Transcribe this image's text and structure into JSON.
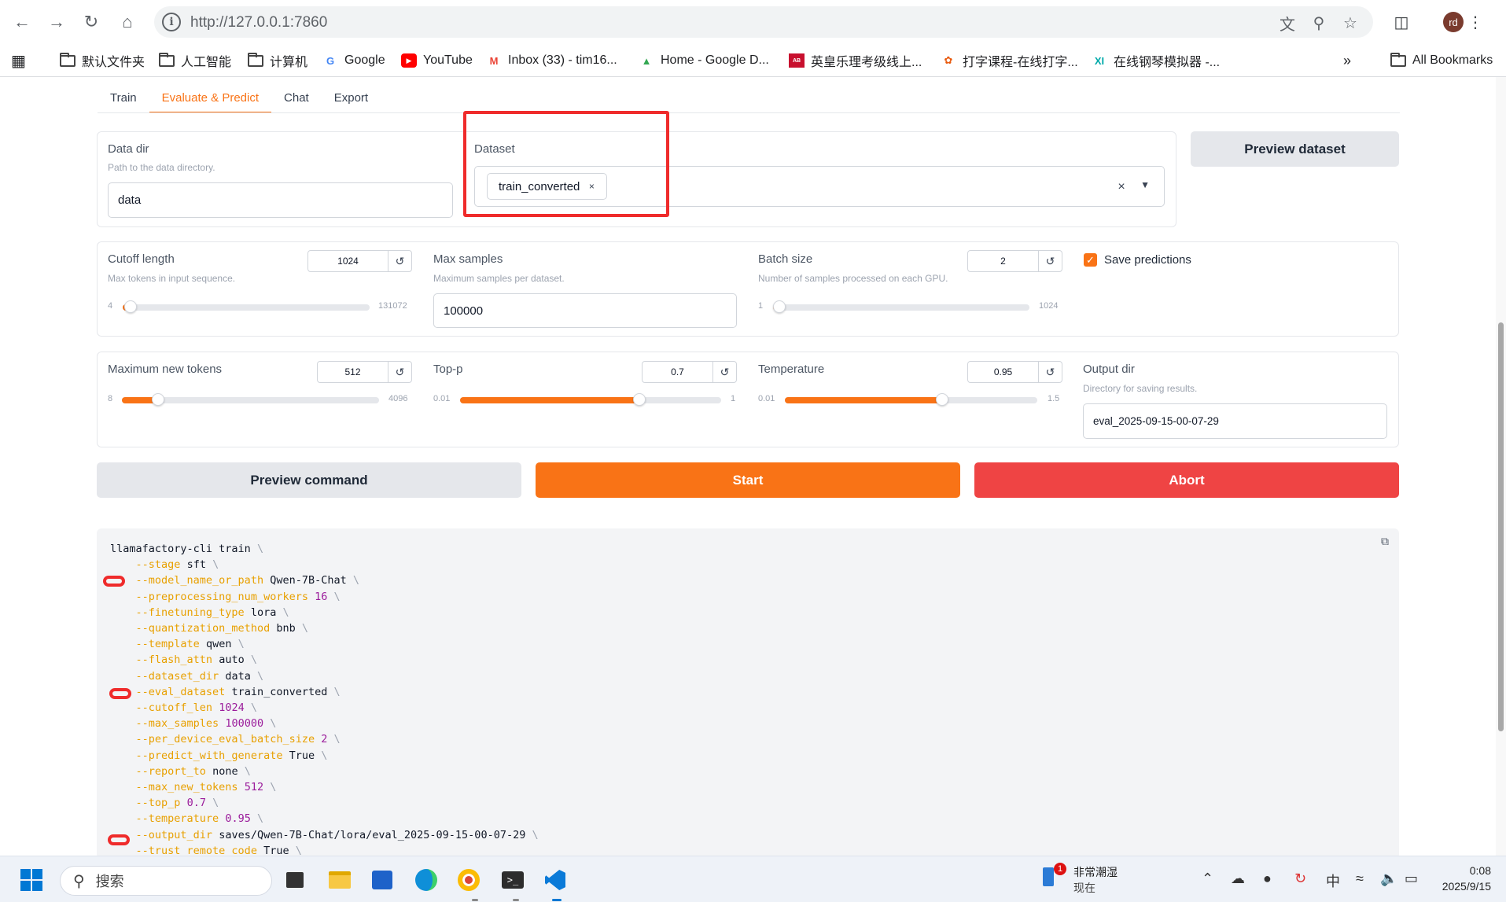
{
  "browser": {
    "url": "http://127.0.0.1:7860",
    "avatar": "rd",
    "bookmarks": [
      {
        "label": "默认文件夹",
        "icon": "folder-icon"
      },
      {
        "label": "人工智能",
        "icon": "folder-icon"
      },
      {
        "label": "计算机",
        "icon": "folder-icon"
      },
      {
        "label": "Google",
        "icon": "google-icon"
      },
      {
        "label": "YouTube",
        "icon": "youtube-icon"
      },
      {
        "label": "Inbox (33) - tim16...",
        "icon": "gmail-icon"
      },
      {
        "label": "Home - Google D...",
        "icon": "drive-icon"
      },
      {
        "label": "英皇乐理考级线上...",
        "icon": "site-icon"
      },
      {
        "label": "打字课程-在线打字...",
        "icon": "site-icon"
      },
      {
        "label": "在线钢琴模拟器 -...",
        "icon": "site-icon"
      }
    ],
    "all_bookmarks": "All Bookmarks"
  },
  "tabs": [
    "Train",
    "Evaluate & Predict",
    "Chat",
    "Export"
  ],
  "active_tab": "Evaluate & Predict",
  "data_dir": {
    "label": "Data dir",
    "info": "Path to the data directory.",
    "value": "data"
  },
  "dataset": {
    "label": "Dataset",
    "chip": "train_converted"
  },
  "preview_dataset": "Preview dataset",
  "cutoff_length": {
    "label": "Cutoff length",
    "info": "Max tokens in input sequence.",
    "value": "1024",
    "min": "4",
    "max": "131072",
    "level": 0.008
  },
  "max_samples": {
    "label": "Max samples",
    "info": "Maximum samples per dataset.",
    "value": "100000"
  },
  "batch_size": {
    "label": "Batch size",
    "info": "Number of samples processed on each GPU.",
    "value": "2",
    "min": "1",
    "max": "1024",
    "level": 0.001
  },
  "save_predictions": {
    "label": "Save predictions",
    "checked": true
  },
  "max_new_tokens": {
    "label": "Maximum new tokens",
    "value": "512",
    "min": "8",
    "max": "4096",
    "level": 0.123
  },
  "top_p": {
    "label": "Top-p",
    "value": "0.7",
    "min": "0.01",
    "max": "1",
    "level": 0.697
  },
  "temperature": {
    "label": "Temperature",
    "value": "0.95",
    "min": "0.01",
    "max": "1.5",
    "level": 0.631
  },
  "output_dir": {
    "label": "Output dir",
    "info": "Directory for saving results.",
    "value": "eval_2025-09-15-00-07-29"
  },
  "buttons": {
    "preview_command": "Preview command",
    "start": "Start",
    "abort": "Abort"
  },
  "colors": {
    "accent": "#f97316",
    "abort": "#ef4444",
    "highlight": "#ef2b2b"
  },
  "command": {
    "head": "llamafactory-cli train",
    "args": [
      {
        "flag": "--stage",
        "value": "sft",
        "numeric": false
      },
      {
        "flag": "--model_name_or_path",
        "value": "Qwen-7B-Chat",
        "numeric": false,
        "marked": true
      },
      {
        "flag": "--preprocessing_num_workers",
        "value": "16",
        "numeric": true
      },
      {
        "flag": "--finetuning_type",
        "value": "lora",
        "numeric": false
      },
      {
        "flag": "--quantization_method",
        "value": "bnb",
        "numeric": false
      },
      {
        "flag": "--template",
        "value": "qwen",
        "numeric": false
      },
      {
        "flag": "--flash_attn",
        "value": "auto",
        "numeric": false
      },
      {
        "flag": "--dataset_dir",
        "value": "data",
        "numeric": false
      },
      {
        "flag": "--eval_dataset",
        "value": "train_converted",
        "numeric": false,
        "marked": true
      },
      {
        "flag": "--cutoff_len",
        "value": "1024",
        "numeric": true
      },
      {
        "flag": "--max_samples",
        "value": "100000",
        "numeric": true
      },
      {
        "flag": "--per_device_eval_batch_size",
        "value": "2",
        "numeric": true
      },
      {
        "flag": "--predict_with_generate",
        "value": "True",
        "numeric": false
      },
      {
        "flag": "--report_to",
        "value": "none",
        "numeric": false
      },
      {
        "flag": "--max_new_tokens",
        "value": "512",
        "numeric": true
      },
      {
        "flag": "--top_p",
        "value": "0.7",
        "numeric": true
      },
      {
        "flag": "--temperature",
        "value": "0.95",
        "numeric": true
      },
      {
        "flag": "--output_dir",
        "value": "saves/Qwen-7B-Chat/lora/eval_2025-09-15-00-07-29",
        "numeric": false,
        "marked": true
      },
      {
        "flag": "--trust_remote_code",
        "value": "True",
        "numeric": false
      }
    ]
  },
  "taskbar": {
    "search": "搜索",
    "weather_title": "非常潮湿",
    "weather_sub": "现在",
    "weather_badge": "1",
    "ime": "中",
    "time": "0:08",
    "date": "2025/9/15"
  }
}
